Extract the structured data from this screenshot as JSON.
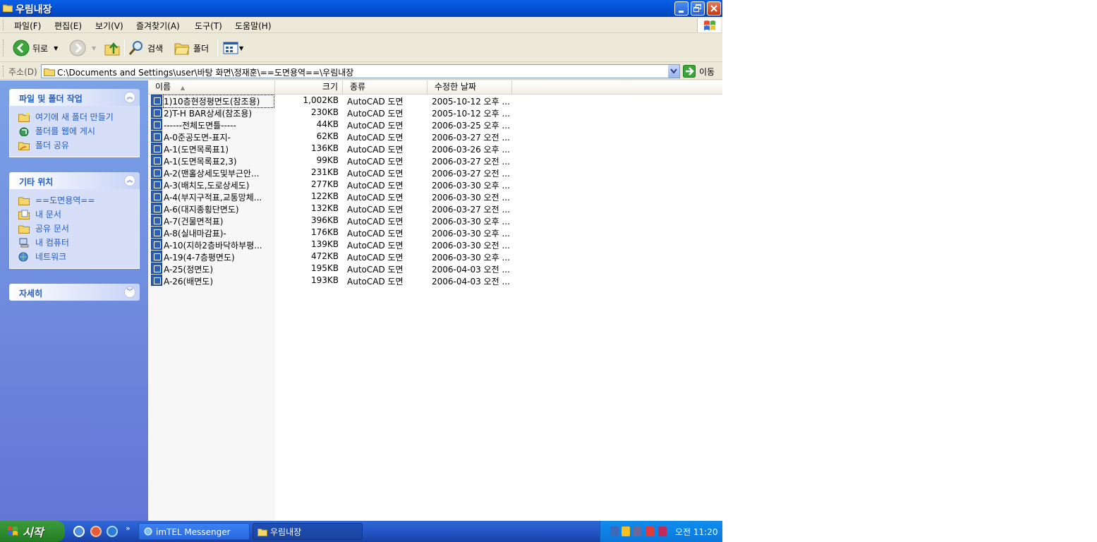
{
  "window": {
    "title": "우림내장"
  },
  "menu": [
    "파일(F)",
    "편집(E)",
    "보기(V)",
    "즐겨찾기(A)",
    "도구(T)",
    "도움말(H)"
  ],
  "toolbar": {
    "back": "뒤로",
    "search": "검색",
    "folders": "폴더"
  },
  "address": {
    "label": "주소(D)",
    "path": "C:\\Documents and Settings\\user\\바탕 화면\\정재훈\\==도면용역==\\우림내장",
    "go": "이동"
  },
  "tasks": {
    "file_folder": {
      "title": "파일 및 폴더 작업",
      "items": [
        "여기에 새 폴더 만들기",
        "폴더를 웹에 게시",
        "폴더 공유"
      ]
    },
    "other_places": {
      "title": "기타 위치",
      "items": [
        "==도면용역==",
        "내 문서",
        "공유 문서",
        "내 컴퓨터",
        "네트워크"
      ]
    },
    "details": {
      "title": "자세히"
    }
  },
  "columns": {
    "name": "이름",
    "size": "크기",
    "type": "종류",
    "modified": "수정한 날짜"
  },
  "files": [
    {
      "name": "1)10층현정평면도(참조용)",
      "size": "1,002KB",
      "type": "AutoCAD 도면",
      "modified": "2005-10-12 오후 ..."
    },
    {
      "name": "2)T-H BAR상세(참조용)",
      "size": "230KB",
      "type": "AutoCAD 도면",
      "modified": "2005-10-12 오후 ..."
    },
    {
      "name": "------전체도면틀-----",
      "size": "44KB",
      "type": "AutoCAD 도면",
      "modified": "2006-03-25 오후 ..."
    },
    {
      "name": "A-0준공도면-표지-",
      "size": "62KB",
      "type": "AutoCAD 도면",
      "modified": "2006-03-27 오전 ..."
    },
    {
      "name": "A-1(도면목록표1)",
      "size": "136KB",
      "type": "AutoCAD 도면",
      "modified": "2006-03-26 오후 ..."
    },
    {
      "name": "A-1(도면목록표2,3)",
      "size": "99KB",
      "type": "AutoCAD 도면",
      "modified": "2006-03-27 오전 ..."
    },
    {
      "name": "A-2(맨홀상세도및부근안...",
      "size": "231KB",
      "type": "AutoCAD 도면",
      "modified": "2006-03-27 오전 ..."
    },
    {
      "name": "A-3(배치도,도로상세도)",
      "size": "277KB",
      "type": "AutoCAD 도면",
      "modified": "2006-03-30 오후 ..."
    },
    {
      "name": "A-4(부지구적표,교통망체...",
      "size": "122KB",
      "type": "AutoCAD 도면",
      "modified": "2006-03-30 오전 ..."
    },
    {
      "name": "A-6(대지종횡단면도)",
      "size": "132KB",
      "type": "AutoCAD 도면",
      "modified": "2006-03-27 오전 ..."
    },
    {
      "name": "A-7(건물면적표)",
      "size": "396KB",
      "type": "AutoCAD 도면",
      "modified": "2006-03-30 오후 ..."
    },
    {
      "name": "A-8(실내마감표)-",
      "size": "176KB",
      "type": "AutoCAD 도면",
      "modified": "2006-03-30 오후 ..."
    },
    {
      "name": "A-10(지하2층바닥하부평...",
      "size": "139KB",
      "type": "AutoCAD 도면",
      "modified": "2006-03-30 오전 ..."
    },
    {
      "name": "A-19(4-7층평면도)",
      "size": "472KB",
      "type": "AutoCAD 도면",
      "modified": "2006-03-30 오후 ..."
    },
    {
      "name": "A-25(정면도)",
      "size": "195KB",
      "type": "AutoCAD 도면",
      "modified": "2006-04-03 오전 ..."
    },
    {
      "name": "A-26(배면도)",
      "size": "193KB",
      "type": "AutoCAD 도면",
      "modified": "2006-04-03 오전 ..."
    }
  ],
  "taskbar": {
    "start": "시작",
    "more": "»",
    "buttons": [
      "imTEL Messenger",
      "우림내장"
    ],
    "clock": "오전 11:20"
  }
}
